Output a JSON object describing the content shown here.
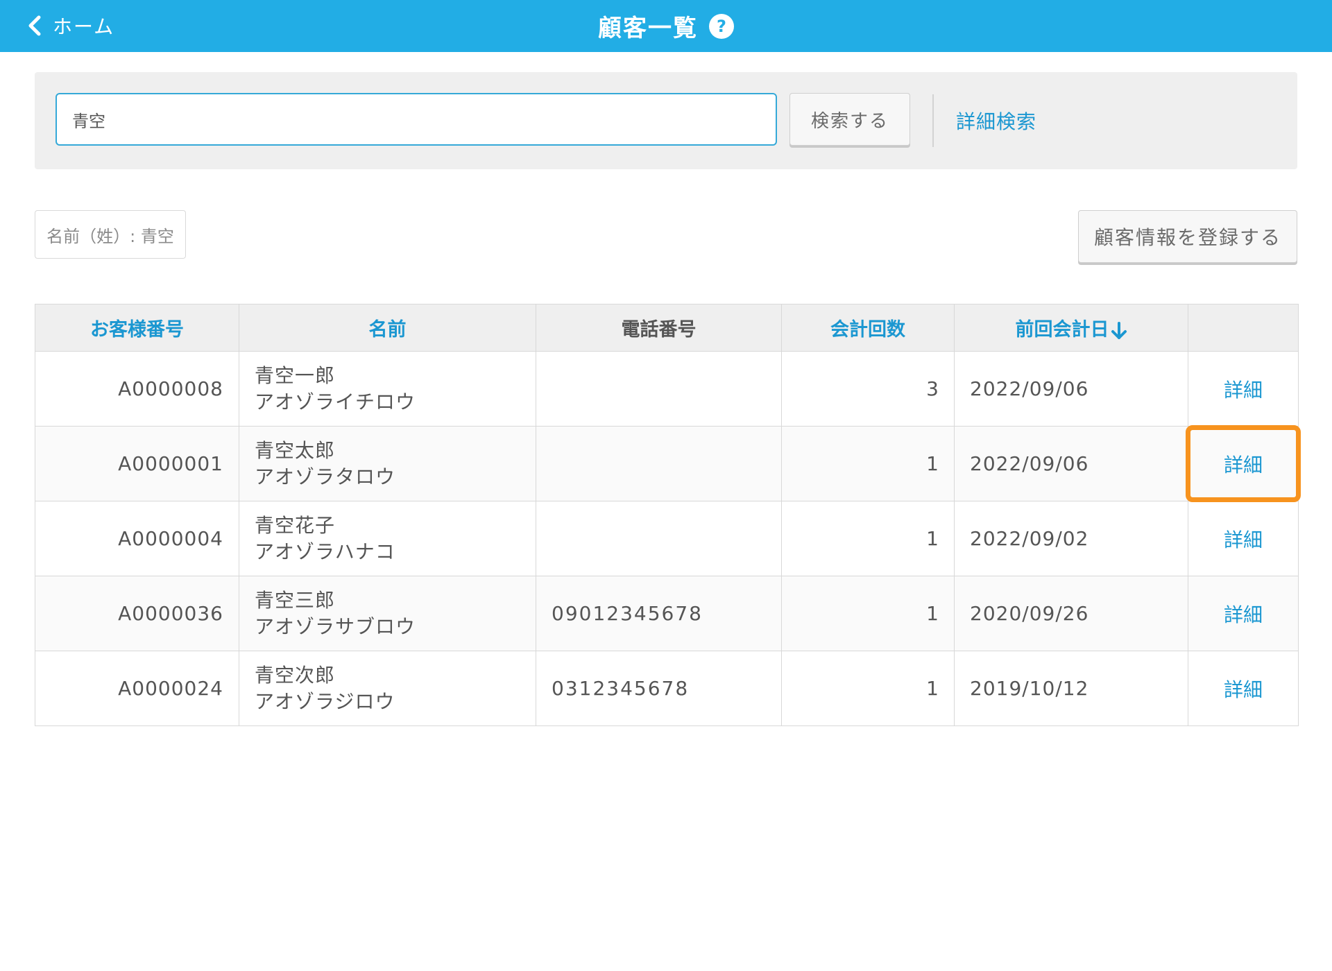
{
  "header": {
    "back_label": "ホーム",
    "title": "顧客一覧",
    "help_glyph": "?"
  },
  "search": {
    "value": "青空",
    "button_label": "検索する",
    "advanced_link": "詳細検索"
  },
  "filter_chip": "名前（姓）: 青空",
  "register_button": "顧客情報を登録する",
  "table": {
    "columns": [
      "お客様番号",
      "名前",
      "電話番号",
      "会計回数",
      "前回会計日",
      ""
    ],
    "rows": [
      {
        "id": "A0000008",
        "name": "青空一郎",
        "kana": "アオゾライチロウ",
        "phone": "",
        "count": "3",
        "last_date": "2022/09/06",
        "action": "詳細"
      },
      {
        "id": "A0000001",
        "name": "青空太郎",
        "kana": "アオゾラタロウ",
        "phone": "",
        "count": "1",
        "last_date": "2022/09/06",
        "action": "詳細"
      },
      {
        "id": "A0000004",
        "name": "青空花子",
        "kana": "アオゾラハナコ",
        "phone": "",
        "count": "1",
        "last_date": "2022/09/02",
        "action": "詳細"
      },
      {
        "id": "A0000036",
        "name": "青空三郎",
        "kana": "アオゾラサブロウ",
        "phone": "09012345678",
        "count": "1",
        "last_date": "2020/09/26",
        "action": "詳細"
      },
      {
        "id": "A0000024",
        "name": "青空次郎",
        "kana": "アオゾラジロウ",
        "phone": "0312345678",
        "count": "1",
        "last_date": "2019/10/12",
        "action": "詳細"
      }
    ]
  },
  "colors": {
    "header_bg": "#22ade5",
    "link": "#1b97d1",
    "highlight": "#f7931e"
  }
}
